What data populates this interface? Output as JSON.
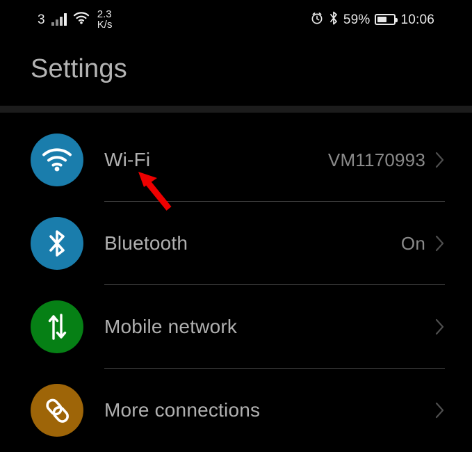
{
  "status_bar": {
    "sim_label": "3",
    "signal_icon": "cellular-signal-icon",
    "wifi_icon": "wifi-icon",
    "net_speed_value": "2.3",
    "net_speed_unit": "K/s",
    "alarm_icon": "alarm-clock-icon",
    "bluetooth_icon": "bluetooth-icon",
    "battery_percent": "59%",
    "battery_level": 59,
    "battery_icon": "battery-icon",
    "time": "10:06"
  },
  "header": {
    "title": "Settings"
  },
  "list": {
    "items": [
      {
        "label": "Wi-Fi",
        "value": "VM1170993",
        "icon": "wifi-icon",
        "icon_color": "#1A7DAC",
        "chevron": "chevron-right-icon"
      },
      {
        "label": "Bluetooth",
        "value": "On",
        "icon": "bluetooth-icon",
        "icon_color": "#1A7DAC",
        "chevron": "chevron-right-icon"
      },
      {
        "label": "Mobile network",
        "value": "",
        "icon": "mobile-network-icon",
        "icon_color": "#068015",
        "chevron": "chevron-right-icon"
      },
      {
        "label": "More connections",
        "value": "",
        "icon": "link-icon",
        "icon_color": "#9E6508",
        "chevron": "chevron-right-icon"
      }
    ]
  },
  "annotation": {
    "arrow_color": "#EE0000",
    "arrow_target": "Wi-Fi"
  },
  "colors": {
    "background": "#000000",
    "label_text": "#b0b0b0",
    "value_text": "#8a8a8a",
    "divider": "#4a4a4a",
    "separator_band": "#1c1c1c"
  }
}
